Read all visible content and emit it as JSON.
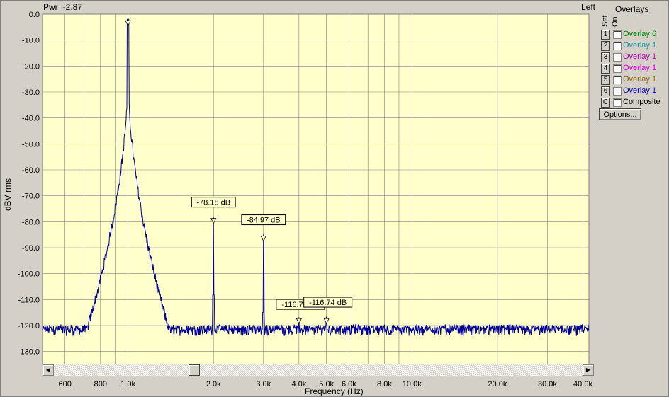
{
  "header": {
    "title": "Pwr=-2.87",
    "channel": "Left"
  },
  "overlays": {
    "title": "Overlays",
    "set_label": "Set",
    "on_label": "On",
    "items": [
      {
        "set": "1",
        "label": "Overlay 6",
        "color": "#008800",
        "checked": false
      },
      {
        "set": "2",
        "label": "Overlay 1",
        "color": "#00a0a0",
        "checked": false
      },
      {
        "set": "3",
        "label": "Overlay 1",
        "color": "#b000b0",
        "checked": false
      },
      {
        "set": "4",
        "label": "Overlay 1",
        "color": "#e000e0",
        "checked": false
      },
      {
        "set": "5",
        "label": "Overlay 1",
        "color": "#886600",
        "checked": false
      },
      {
        "set": "6",
        "label": "Overlay 1",
        "color": "#0000c0",
        "checked": false
      },
      {
        "set": "C",
        "label": "Composite",
        "color": "#000000",
        "checked": false
      }
    ],
    "options_label": "Options..."
  },
  "chart_data": {
    "type": "line",
    "xlabel": "Frequency (Hz)",
    "ylabel": "dBV rms",
    "xscale": "log",
    "xlim": [
      500,
      42000
    ],
    "ylim": [
      -135,
      0
    ],
    "grid": true,
    "y_ticks": [
      0,
      -10,
      -20,
      -30,
      -40,
      -50,
      -60,
      -70,
      -80,
      -90,
      -100,
      -110,
      -120,
      -130
    ],
    "y_tick_labels": [
      "0.0",
      "-10.0",
      "-20.0",
      "-30.0",
      "-40.0",
      "-50.0",
      "-60.0",
      "-70.0",
      "-80.0",
      "-90.0",
      "-100.0",
      "-110.0",
      "-120.0",
      "-130.0"
    ],
    "x_ticks": [
      600,
      800,
      1000,
      2000,
      3000,
      4000,
      5000,
      6000,
      8000,
      10000,
      20000,
      30000,
      40000
    ],
    "x_tick_labels": [
      "600",
      "800",
      "1.0k",
      "2.0k",
      "3.0k",
      "4.0k",
      "5.0k",
      "6.0k",
      "8.0k",
      "10.0k",
      "20.0k",
      "30.0k",
      "40.0k"
    ],
    "colors": {
      "background": "#ffffcc",
      "grid": "#808080",
      "trace": "#000099",
      "label_box": "#ffffcc"
    },
    "noise_floor_db": -123,
    "series": [
      {
        "peaks": [
          {
            "freq": 1000,
            "level": -2.0
          },
          {
            "freq": 2000,
            "level": -78.18
          },
          {
            "freq": 3000,
            "level": -84.97
          },
          {
            "freq": 4000,
            "level": -116.76
          },
          {
            "freq": 5000,
            "level": -116.74
          }
        ]
      }
    ],
    "markers": [
      {
        "freq": 1000,
        "level": -2.0,
        "label": ""
      },
      {
        "freq": 2000,
        "level": -78.18,
        "label": "-78.18 dB"
      },
      {
        "freq": 3000,
        "level": -84.97,
        "label": "-84.97 dB"
      },
      {
        "freq": 4000,
        "level": -116.76,
        "label": "-116.76 dB"
      },
      {
        "freq": 5000,
        "level": -116.74,
        "label": "-116.74 dB"
      }
    ]
  },
  "scrollbar": {
    "position": 0.26
  }
}
